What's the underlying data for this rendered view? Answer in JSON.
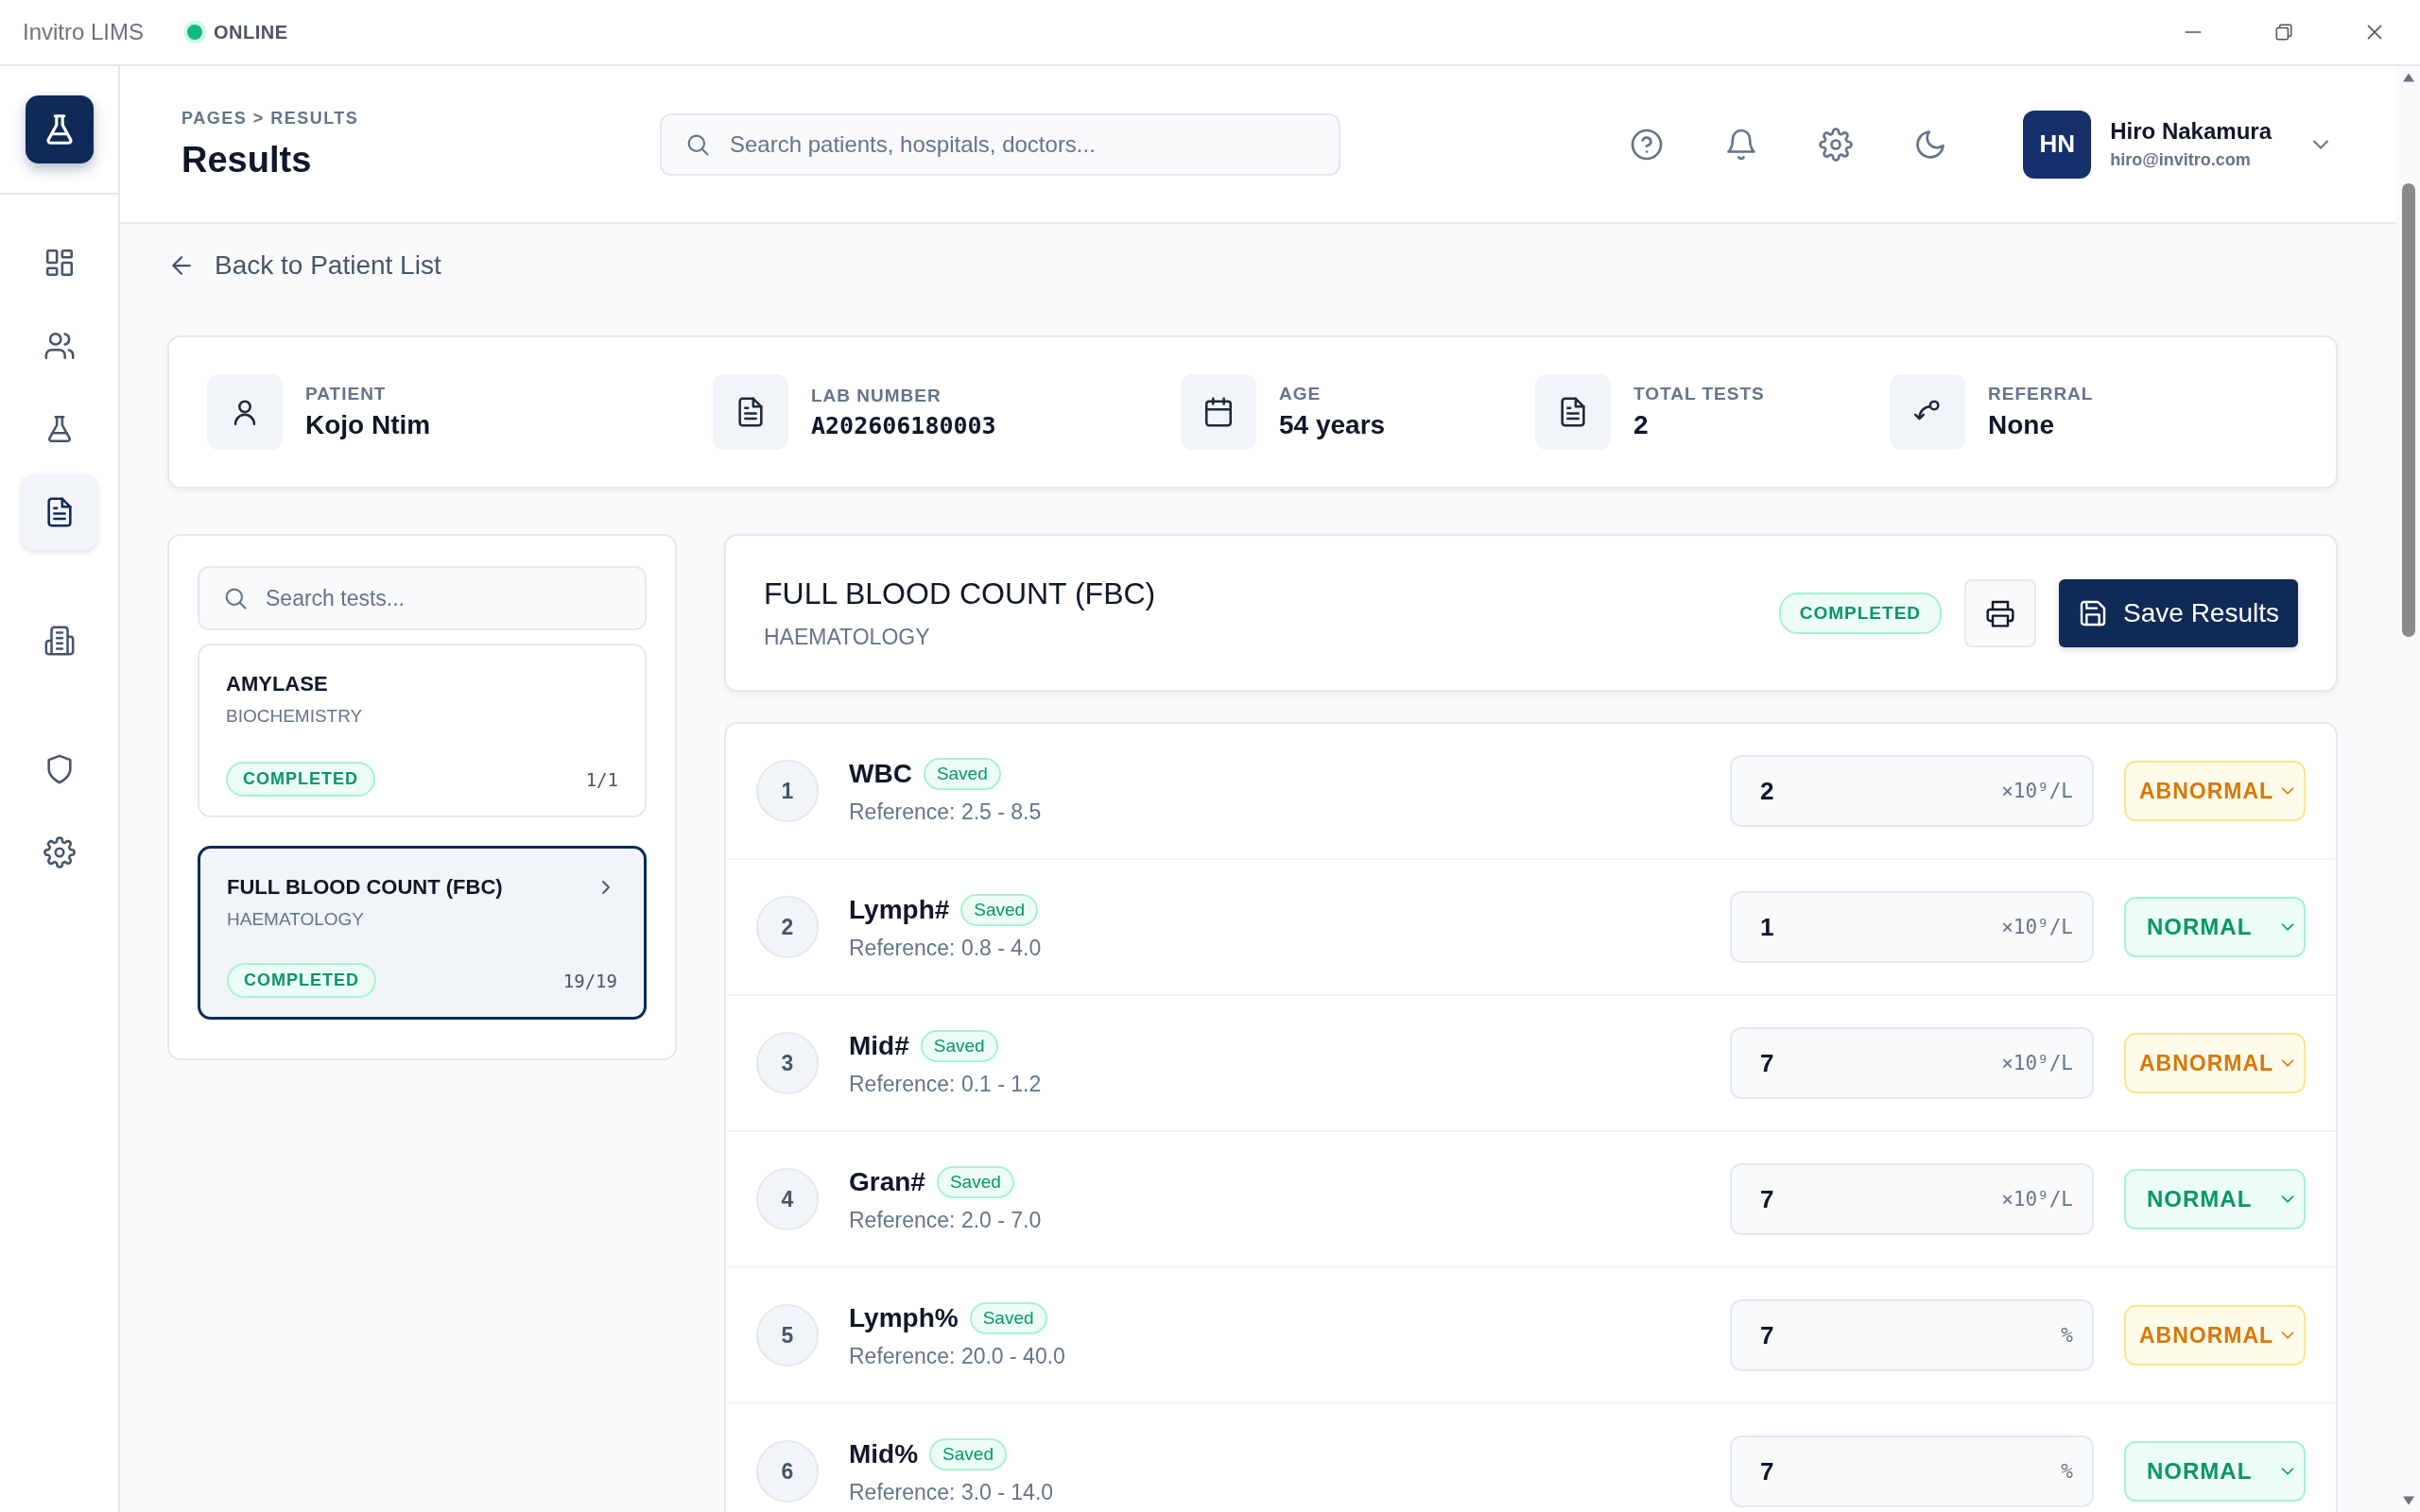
{
  "window": {
    "title": "Invitro LIMS",
    "status": "ONLINE",
    "online": true
  },
  "sidebar": {
    "items": [
      {
        "selected": false
      },
      {
        "selected": false
      },
      {
        "selected": false
      },
      {
        "selected": true
      },
      {
        "selected": false
      },
      {
        "selected": false
      },
      {
        "selected": false
      }
    ]
  },
  "header": {
    "breadcrumb": "PAGES > RESULTS",
    "title": "Results",
    "search": {
      "placeholder": "Search patients, hospitals, doctors..."
    },
    "user": {
      "initials": "HN",
      "name": "Hiro Nakamura",
      "email": "hiro@invitro.com"
    }
  },
  "back_link": "Back to Patient List",
  "patient": [
    {
      "label": "PATIENT",
      "value": "Kojo Ntim"
    },
    {
      "label": "LAB NUMBER",
      "value": "A202606180003"
    },
    {
      "label": "AGE",
      "value": "54 years"
    },
    {
      "label": "TOTAL TESTS",
      "value": "2"
    },
    {
      "label": "REFERRAL",
      "value": "None"
    }
  ],
  "tests": {
    "search": {
      "placeholder": "Search tests..."
    },
    "items": [
      {
        "name": "AMYLASE",
        "department": "BIOCHEMISTRY",
        "status": "COMPLETED",
        "count": "1/1",
        "selected": false
      },
      {
        "name": "FULL BLOOD COUNT (FBC)",
        "department": "HAEMATOLOGY",
        "status": "COMPLETED",
        "count": "19/19",
        "selected": true
      }
    ]
  },
  "detail": {
    "title": "FULL BLOOD COUNT (FBC)",
    "department": "HAEMATOLOGY",
    "status": "COMPLETED",
    "save_button": "Save Results"
  },
  "results": [
    {
      "number": "1",
      "name": "WBC",
      "badge": "Saved",
      "reference": "Reference: 2.5 - 8.5",
      "value": "2",
      "unit": "×10⁹/L",
      "flag": "ABNORMAL",
      "kind": "abnormal"
    },
    {
      "number": "2",
      "name": "Lymph#",
      "badge": "Saved",
      "reference": "Reference: 0.8 - 4.0",
      "value": "1",
      "unit": "×10⁹/L",
      "flag": "NORMAL",
      "kind": "normal"
    },
    {
      "number": "3",
      "name": "Mid#",
      "badge": "Saved",
      "reference": "Reference: 0.1 - 1.2",
      "value": "7",
      "unit": "×10⁹/L",
      "flag": "ABNORMAL",
      "kind": "abnormal"
    },
    {
      "number": "4",
      "name": "Gran#",
      "badge": "Saved",
      "reference": "Reference: 2.0 - 7.0",
      "value": "7",
      "unit": "×10⁹/L",
      "flag": "NORMAL",
      "kind": "normal"
    },
    {
      "number": "5",
      "name": "Lymph%",
      "badge": "Saved",
      "reference": "Reference: 20.0 - 40.0",
      "value": "7",
      "unit": "%",
      "flag": "ABNORMAL",
      "kind": "abnormal"
    },
    {
      "number": "6",
      "name": "Mid%",
      "badge": "Saved",
      "reference": "Reference: 3.0 - 14.0",
      "value": "7",
      "unit": "%",
      "flag": "NORMAL",
      "kind": "normal"
    }
  ]
}
